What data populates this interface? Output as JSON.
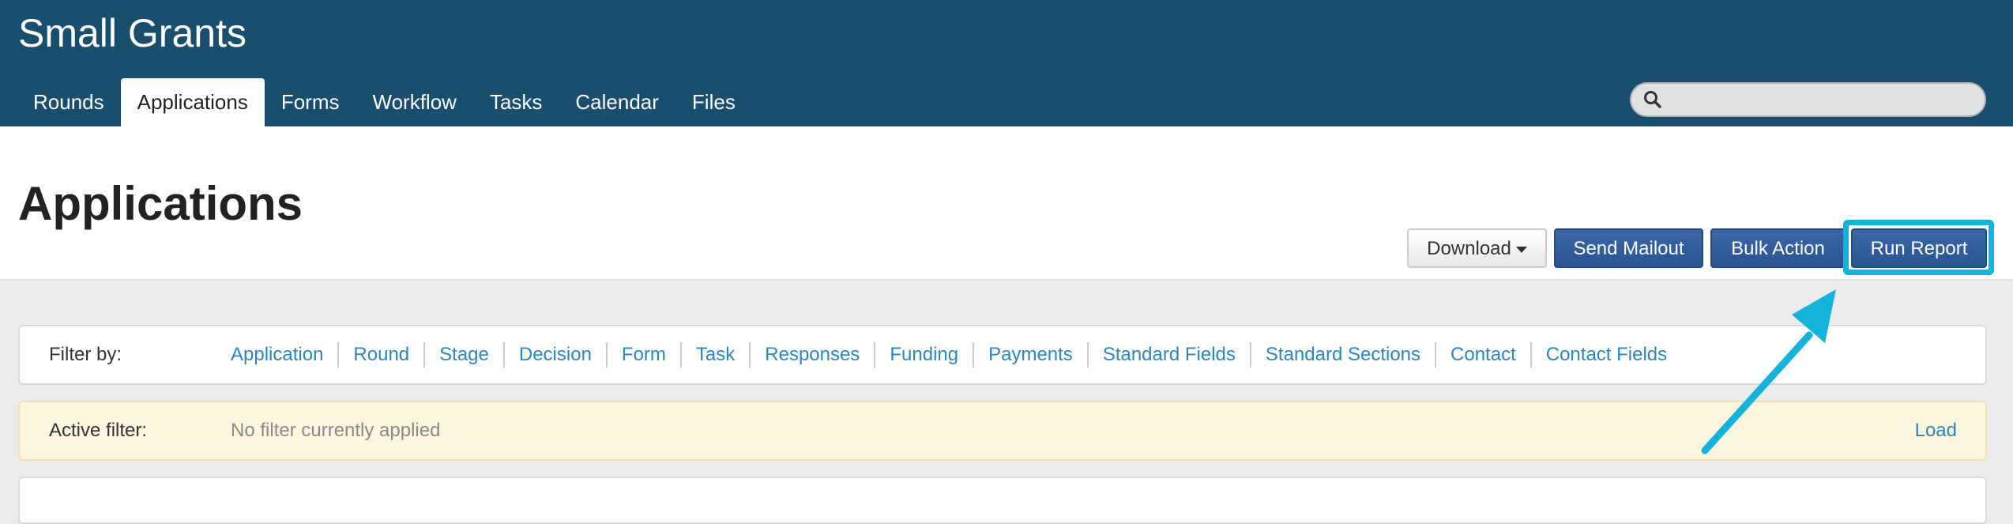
{
  "header": {
    "title": "Small Grants",
    "nav_tabs": [
      {
        "label": "Rounds",
        "active": false
      },
      {
        "label": "Applications",
        "active": true
      },
      {
        "label": "Forms",
        "active": false
      },
      {
        "label": "Workflow",
        "active": false
      },
      {
        "label": "Tasks",
        "active": false
      },
      {
        "label": "Calendar",
        "active": false
      },
      {
        "label": "Files",
        "active": false
      }
    ],
    "search": {
      "value": "",
      "icon": "search-icon"
    }
  },
  "page": {
    "title": "Applications",
    "buttons": {
      "download": "Download",
      "send_mailout": "Send Mailout",
      "bulk_action": "Bulk Action",
      "run_report": "Run Report"
    }
  },
  "filter": {
    "label": "Filter by:",
    "links": [
      "Application",
      "Round",
      "Stage",
      "Decision",
      "Form",
      "Task",
      "Responses",
      "Funding",
      "Payments",
      "Standard Fields",
      "Standard Sections",
      "Contact",
      "Contact Fields"
    ]
  },
  "active_filter": {
    "label": "Active filter:",
    "value": "No filter currently applied",
    "load": "Load"
  },
  "colors": {
    "header_bg": "#194f6e",
    "primary_button": "#2a5391",
    "highlight": "#12b3dc",
    "link": "#2e86c1",
    "active_filter_bg": "#fcf6dc"
  }
}
